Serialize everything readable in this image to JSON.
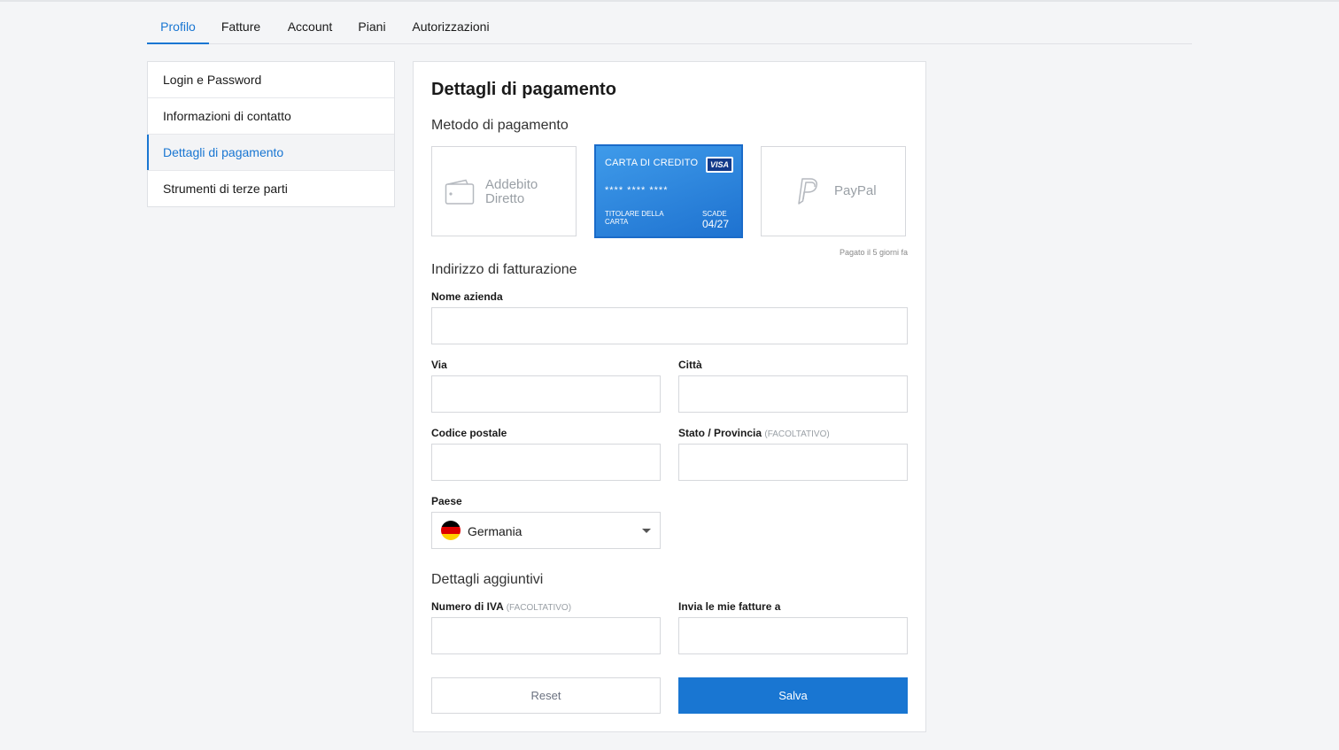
{
  "tabs": [
    {
      "label": "Profilo"
    },
    {
      "label": "Fatture"
    },
    {
      "label": "Account"
    },
    {
      "label": "Piani"
    },
    {
      "label": "Autorizzazioni"
    }
  ],
  "sidebar": {
    "items": [
      {
        "label": "Login e Password"
      },
      {
        "label": "Informazioni di contatto"
      },
      {
        "label": "Dettagli di pagamento"
      },
      {
        "label": "Strumenti di terze parti"
      }
    ]
  },
  "main": {
    "title": "Dettagli di pagamento",
    "payment_section": "Metodo di pagamento",
    "methods": {
      "debit_label": "Addebito Diretto",
      "card": {
        "title": "CARTA DI CREDITO",
        "brand": "VISA",
        "number": "**** **** ****",
        "holder_label": "TITOLARE DELLA CARTA",
        "expiry_label": "SCADE",
        "expiry": "04/27"
      },
      "paypal_label": "PayPal"
    },
    "paid_note": "Pagato il 5 giorni fa",
    "billing_section": "Indirizzo di fatturazione",
    "fields": {
      "company": {
        "label": "Nome azienda",
        "value": ""
      },
      "street": {
        "label": "Via",
        "value": ""
      },
      "city": {
        "label": "Città",
        "value": ""
      },
      "postal": {
        "label": "Codice postale",
        "value": ""
      },
      "state": {
        "label": "Stato / Provincia",
        "optional": "(FACOLTATIVO)",
        "value": ""
      },
      "country": {
        "label": "Paese",
        "value": "Germania"
      },
      "vat": {
        "label": "Numero di IVA",
        "optional": "(FACOLTATIVO)",
        "value": ""
      },
      "send_to": {
        "label": "Invia le mie fatture a",
        "value": ""
      }
    },
    "extra_section": "Dettagli aggiuntivi",
    "buttons": {
      "reset": "Reset",
      "save": "Salva"
    }
  },
  "colors": {
    "accent": "#1976d2",
    "card_gradient_start": "#3f9bea",
    "card_gradient_end": "#1e72d0",
    "flag": [
      "#000000",
      "#dd0000",
      "#ffce00"
    ]
  },
  "icons": [
    "wallet-icon",
    "paypal-icon",
    "visa-logo",
    "germany-flag-icon",
    "chevron-down-icon"
  ]
}
